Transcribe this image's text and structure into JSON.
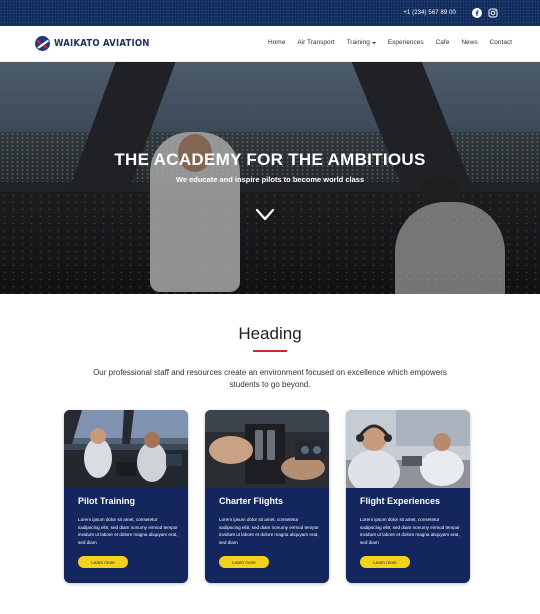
{
  "topbar": {
    "phone": "+1 (234) 567 89 00",
    "icons": [
      "facebook-icon",
      "instagram-icon"
    ],
    "bg_color": "#0d2a5c"
  },
  "navbar": {
    "logo_text": "WAIKATO AVIATION",
    "menu": [
      {
        "label": "Home"
      },
      {
        "label": "Air Transport"
      },
      {
        "label": "Training",
        "has_dropdown": true
      },
      {
        "label": "Experiences"
      },
      {
        "label": "Cafe"
      },
      {
        "label": "News"
      },
      {
        "label": "Contact"
      }
    ]
  },
  "hero": {
    "title": "THE ACADEMY FOR THE AMBITIOUS",
    "subtitle": "We educate and inspire pilots to become world class",
    "chevron_icon": "chevron-down-icon"
  },
  "intro": {
    "heading": "Heading",
    "text": "Our professional staff and resources create an environment focused on excellence which empowers students to go beyond.",
    "rule_color": "#d0262f"
  },
  "cards": [
    {
      "title": "Pilot Training",
      "text": "Lorem ipsum dolor sit amet, consetetur sadipscing elitr, sed diam nonumy eirmod tempor invidunt ut labore et dolore magna aliquyam erat, sed diam",
      "button": "Learn more"
    },
    {
      "title": "Charter Flights",
      "text": "Lorem ipsum dolor sit amet, consetetur sadipscing elitr, sed diam nonumy eirmod tempor invidunt ut labore et dolore magna aliquyam erat, sed diam",
      "button": "Learn more"
    },
    {
      "title": "Flight Experiences",
      "text": "Lorem ipsum dolor sit amet, consetetur sadipscing elitr, sed diam nonumy eirmod tempor invidunt ut labore et dolore magna aliquyam erat, sed diam",
      "button": "Learn more"
    }
  ],
  "colors": {
    "card_bg": "#13265e",
    "button_bg": "#f2d21a",
    "accent_red": "#d0262f"
  }
}
